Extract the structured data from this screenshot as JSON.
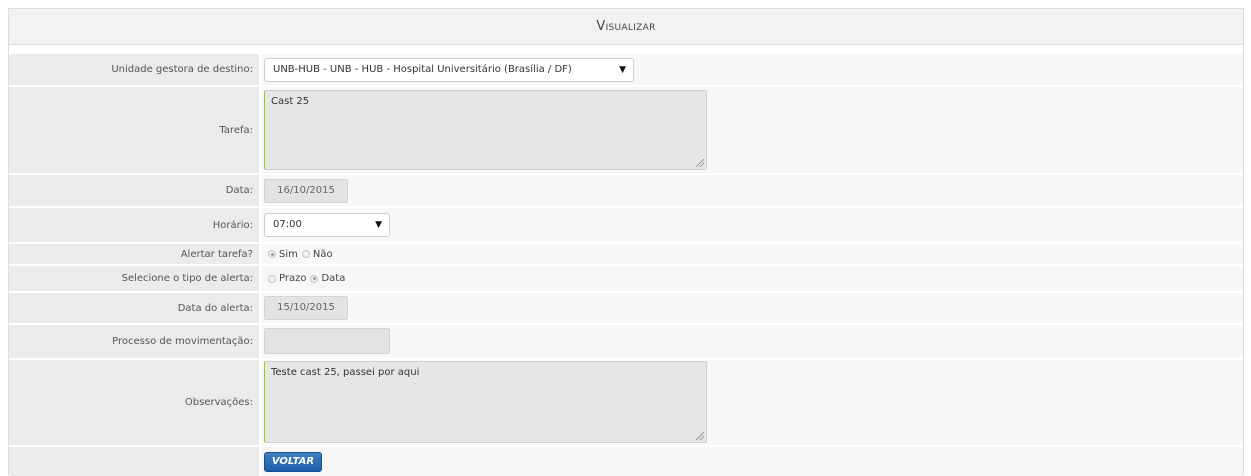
{
  "page": {
    "title": "Visualizar"
  },
  "form": {
    "unidade": {
      "label": "Unidade gestora de destino:",
      "value": "UNB-HUB - UNB - HUB - Hospital Universitário (Brasília / DF)",
      "caret": "▼"
    },
    "tarefa": {
      "label": "Tarefa:",
      "value": "Cast 25"
    },
    "data": {
      "label": "Data:",
      "value": "16/10/2015"
    },
    "horario": {
      "label": "Horário:",
      "value": "07:00",
      "caret": "▼"
    },
    "alertar": {
      "label": "Alertar tarefa?",
      "options": [
        {
          "label": "Sim",
          "checked": true
        },
        {
          "label": "Não",
          "checked": false
        }
      ]
    },
    "tipo_alerta": {
      "label": "Selecione o tipo de alerta:",
      "options": [
        {
          "label": "Prazo",
          "checked": false
        },
        {
          "label": "Data",
          "checked": true
        }
      ]
    },
    "data_alerta": {
      "label": "Data do alerta:",
      "value": "15/10/2015"
    },
    "processo": {
      "label": "Processo de movimentação:",
      "value": ""
    },
    "observacoes": {
      "label": "Observações:",
      "value": "Teste cast 25, passei por aqui"
    }
  },
  "actions": {
    "voltar_label": "VOLTAR"
  },
  "colors": {
    "label_bg": "#ebebeb",
    "field_bg": "#f7f7f7",
    "button_blue": "#2a6db5",
    "textarea_accent": "#9bbf5a"
  }
}
